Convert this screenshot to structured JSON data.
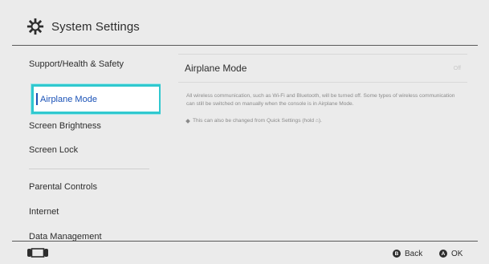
{
  "header": {
    "title": "System Settings",
    "icon": "gear-icon"
  },
  "sidebar": {
    "items": [
      {
        "label": "Support/Health & Safety"
      },
      {
        "label": "Airplane Mode",
        "selected": true
      },
      {
        "label": "Screen Brightness"
      },
      {
        "label": "Screen Lock"
      },
      {
        "label": "Parental Controls"
      },
      {
        "label": "Internet"
      },
      {
        "label": "Data Management"
      }
    ]
  },
  "content": {
    "title": "Airplane Mode",
    "status": "Off",
    "description": "All wireless communication, such as Wi-Fi and Bluetooth, will be turned off. Some types of wireless communication can still be switched on manually when the console is in Airplane Mode.",
    "note": "This can also be changed from Quick Settings (hold ⌂)."
  },
  "footer": {
    "back_key": "B",
    "back_label": "Back",
    "ok_key": "A",
    "ok_label": "OK"
  },
  "colors": {
    "accent": "#30c8cf",
    "selected_text": "#1a52b7",
    "background": "#ebebeb"
  }
}
